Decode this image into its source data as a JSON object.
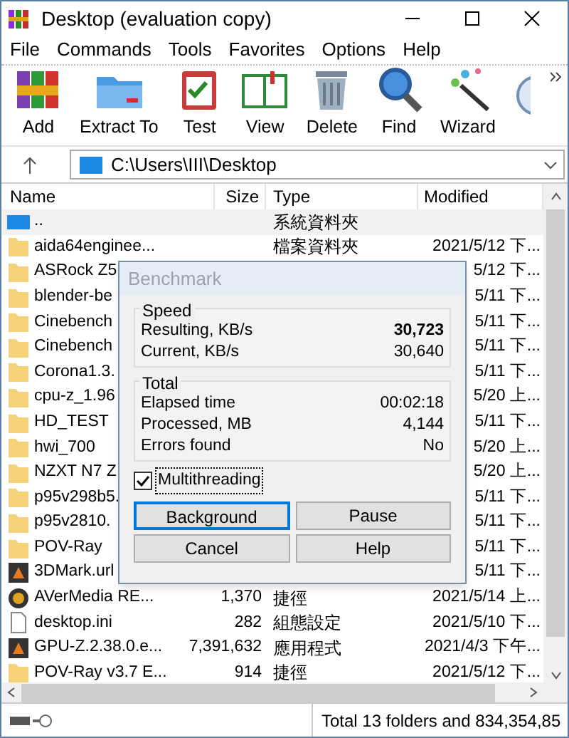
{
  "window": {
    "title": "Desktop (evaluation copy)"
  },
  "menu": [
    {
      "label": "File"
    },
    {
      "label": "Commands"
    },
    {
      "label": "Tools"
    },
    {
      "label": "Favorites"
    },
    {
      "label": "Options"
    },
    {
      "label": "Help"
    }
  ],
  "toolbar": [
    {
      "label": "Add",
      "kind": "books"
    },
    {
      "label": "Extract To",
      "kind": "folder"
    },
    {
      "label": "Test",
      "kind": "clipboard"
    },
    {
      "label": "View",
      "kind": "book"
    },
    {
      "label": "Delete",
      "kind": "trash"
    },
    {
      "label": "Find",
      "kind": "magnifier"
    },
    {
      "label": "Wizard",
      "kind": "wand"
    }
  ],
  "address": {
    "value": "C:\\Users\\III\\Desktop"
  },
  "table": {
    "columns": [
      "Name",
      "Size",
      "Type",
      "Modified"
    ],
    "rows": [
      {
        "kind": "up",
        "name": "..",
        "type": "系統資料夾"
      },
      {
        "kind": "folder",
        "name": "aida64enginee...",
        "type": "檔案資料夾",
        "modified": "2021/5/12 下..."
      },
      {
        "kind": "folder",
        "name": "ASRock Z5",
        "modified": "5/12 下..."
      },
      {
        "kind": "folder",
        "name": "blender-be",
        "modified": "5/11 下..."
      },
      {
        "kind": "folder",
        "name": "Cinebench",
        "modified": "5/11 下..."
      },
      {
        "kind": "folder",
        "name": "Cinebench",
        "modified": "5/11 下..."
      },
      {
        "kind": "folder",
        "name": "Corona1.3.",
        "modified": "5/11 下..."
      },
      {
        "kind": "folder",
        "name": "cpu-z_1.96",
        "modified": "5/20 上..."
      },
      {
        "kind": "folder",
        "name": "HD_TEST",
        "modified": "5/11 下..."
      },
      {
        "kind": "folder",
        "name": "hwi_700",
        "modified": "5/20 上..."
      },
      {
        "kind": "folder",
        "name": "NZXT N7 Z",
        "modified": "5/20 上..."
      },
      {
        "kind": "folder",
        "name": "p95v298b5.",
        "modified": "5/11 下..."
      },
      {
        "kind": "folder",
        "name": "p95v2810.",
        "modified": "5/11 下..."
      },
      {
        "kind": "folder",
        "name": "POV-Ray",
        "modified": "5/11 下..."
      },
      {
        "kind": "app",
        "name": "3DMark.url",
        "modified": "5/11 下..."
      },
      {
        "kind": "disc",
        "name": "AVerMedia RE...",
        "size": "1,370",
        "type": "捷徑",
        "modified": "2021/5/14 上..."
      },
      {
        "kind": "file",
        "name": "desktop.ini",
        "size": "282",
        "type": "組態設定",
        "modified": "2021/5/10 下..."
      },
      {
        "kind": "app",
        "name": "GPU-Z.2.38.0.e...",
        "size": "7,391,632",
        "type": "應用程式",
        "modified": "2021/4/3 下午..."
      },
      {
        "kind": "folder",
        "name": "POV-Ray v3.7 E...",
        "size": "914",
        "type": "捷徑",
        "modified": "2021/5/12 下..."
      }
    ]
  },
  "status_bar": {
    "text": "Total 13 folders and 834,354,85"
  },
  "dialog": {
    "title": "Benchmark",
    "groups": [
      {
        "title": "Speed",
        "rows": [
          {
            "label": "Resulting, KB/s",
            "value": "30,723",
            "bold": true
          },
          {
            "label": "Current, KB/s",
            "value": "30,640",
            "bold": false
          }
        ]
      },
      {
        "title": "Total",
        "rows": [
          {
            "label": "Elapsed time",
            "value": "00:02:18",
            "bold": false
          },
          {
            "label": "Processed, MB",
            "value": "4,144",
            "bold": false
          },
          {
            "label": "Errors found",
            "value": "No",
            "bold": false
          }
        ]
      }
    ],
    "multithreading": {
      "label": "Multithreading",
      "checked": true
    },
    "buttons": [
      {
        "label": "Background",
        "selected": true
      },
      {
        "label": "Pause",
        "selected": false
      },
      {
        "label": "Cancel",
        "selected": false
      },
      {
        "label": "Help",
        "selected": false
      }
    ]
  }
}
